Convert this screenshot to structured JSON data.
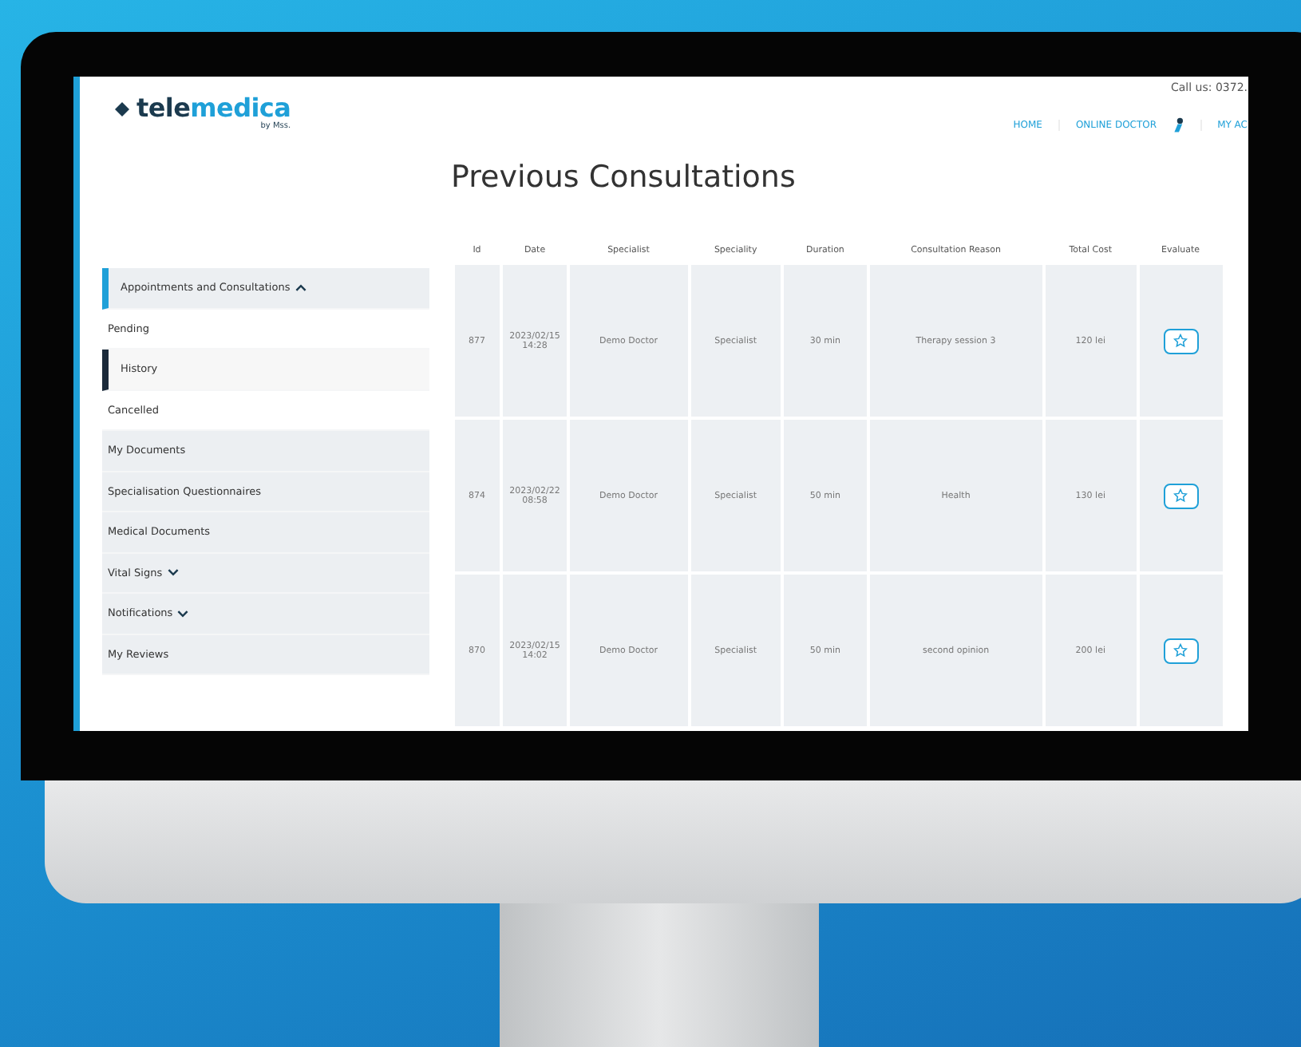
{
  "header": {
    "logo": {
      "part_1": "tele",
      "part_2": "medica",
      "tagline": "by Mss."
    },
    "call_us": "Call us: 0372.",
    "nav": [
      {
        "label": "HOME",
        "kind": "link"
      },
      {
        "label": "ONLINE DOCTOR",
        "kind": "link"
      },
      {
        "kind": "user"
      },
      {
        "label": "MY AC",
        "kind": "link"
      }
    ]
  },
  "page_title": "Previous Consultations",
  "sidebar": {
    "items": [
      {
        "label": "Appointments and Consultations",
        "kind": "group",
        "expanded": true,
        "selected": false,
        "children": [
          {
            "label": "Pending",
            "selected": false
          },
          {
            "label": "History",
            "selected": true
          },
          {
            "label": "Cancelled",
            "selected": false
          }
        ]
      },
      {
        "label": "My Documents",
        "kind": "link",
        "selected": false
      },
      {
        "label": "Specialisation Questionnaires",
        "kind": "link",
        "selected": false
      },
      {
        "label": "Medical Documents",
        "kind": "link",
        "selected": false
      },
      {
        "label": "Vital Signs",
        "kind": "group",
        "expanded": false,
        "selected": false
      },
      {
        "label": "Notifications",
        "kind": "group",
        "expanded": false,
        "selected": false
      },
      {
        "label": "My Reviews",
        "kind": "link",
        "selected": false
      }
    ]
  },
  "table": {
    "columns": [
      "Id",
      "Date",
      "Specialist",
      "Speciality",
      "Duration",
      "Consultation Reason",
      "Total Cost",
      "Evaluate"
    ],
    "rows": [
      {
        "id": "877",
        "date": "2023/02/15 14:28",
        "specialist": "Demo Doctor",
        "speciality": "Specialist",
        "duration": "30 min",
        "reason": "Therapy session 3",
        "cost": "120 lei"
      },
      {
        "id": "874",
        "date": "2023/02/22 08:58",
        "specialist": "Demo Doctor",
        "speciality": "Specialist",
        "duration": "50 min",
        "reason": "Health",
        "cost": "130 lei"
      },
      {
        "id": "870",
        "date": "2023/02/15 14:02",
        "specialist": "Demo Doctor",
        "speciality": "Specialist",
        "duration": "50 min",
        "reason": "second opinion",
        "cost": "200 lei"
      }
    ]
  }
}
